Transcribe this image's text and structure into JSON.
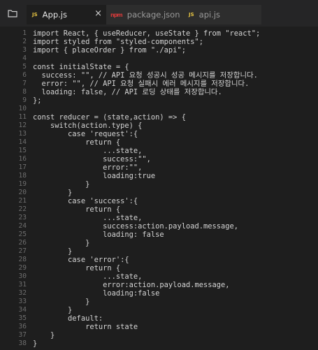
{
  "tabs": [
    {
      "label": "App.js",
      "icon": "JS"
    },
    {
      "label": "package.json",
      "icon": "npm"
    },
    {
      "label": "api.js",
      "icon": "JS"
    }
  ],
  "close_glyph": "×",
  "code_lines": [
    {
      "n": "1",
      "text": "import React, { useReducer, useState } from \"react\";"
    },
    {
      "n": "2",
      "text": "import styled from \"styled-components\";"
    },
    {
      "n": "3",
      "text": "import { placeOrder } from \"./api\";"
    },
    {
      "n": "4",
      "text": ""
    },
    {
      "n": "5",
      "text": "const initialState = {"
    },
    {
      "n": "6",
      "text": "  success: \"\", // API 요청 성공시 성공 메시지를 저장합니다."
    },
    {
      "n": "7",
      "text": "  error: \"\", // API 요청 실패시 에러 메시지를 저장합니다."
    },
    {
      "n": "8",
      "text": "  loading: false, // API 로딩 상태를 저장합니다."
    },
    {
      "n": "9",
      "text": "};"
    },
    {
      "n": "10",
      "text": ""
    },
    {
      "n": "11",
      "text": "const reducer = (state,action) => {"
    },
    {
      "n": "12",
      "text": "    switch(action.type) {"
    },
    {
      "n": "13",
      "text": "        case 'request':{"
    },
    {
      "n": "14",
      "text": "            return {"
    },
    {
      "n": "15",
      "text": "                ...state,"
    },
    {
      "n": "16",
      "text": "                success:\"\","
    },
    {
      "n": "17",
      "text": "                error:\"\","
    },
    {
      "n": "18",
      "text": "                loading:true"
    },
    {
      "n": "19",
      "text": "            }"
    },
    {
      "n": "20",
      "text": "        }"
    },
    {
      "n": "21",
      "text": "        case 'success':{"
    },
    {
      "n": "22",
      "text": "            return {"
    },
    {
      "n": "23",
      "text": "                ...state,"
    },
    {
      "n": "24",
      "text": "                success:action.payload.message,"
    },
    {
      "n": "25",
      "text": "                loading: false"
    },
    {
      "n": "26",
      "text": "            }"
    },
    {
      "n": "27",
      "text": "        }"
    },
    {
      "n": "28",
      "text": "        case 'error':{"
    },
    {
      "n": "29",
      "text": "            return {"
    },
    {
      "n": "30",
      "text": "                ...state,"
    },
    {
      "n": "31",
      "text": "                error:action.payload.message,"
    },
    {
      "n": "32",
      "text": "                loading:false"
    },
    {
      "n": "33",
      "text": "            }"
    },
    {
      "n": "34",
      "text": "        }"
    },
    {
      "n": "35",
      "text": "        default:"
    },
    {
      "n": "36",
      "text": "            return state"
    },
    {
      "n": "37",
      "text": "    }"
    },
    {
      "n": "38",
      "text": "}"
    }
  ]
}
